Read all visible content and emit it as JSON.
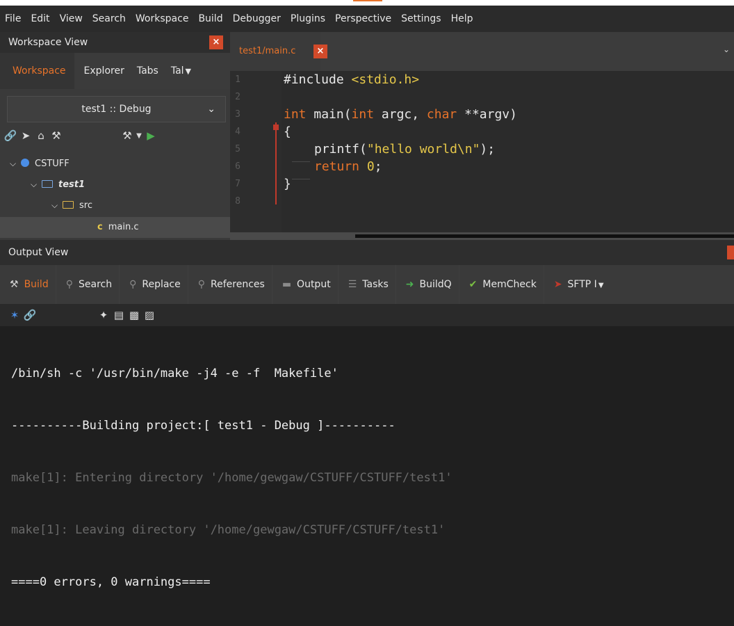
{
  "menu": [
    "File",
    "Edit",
    "View",
    "Search",
    "Workspace",
    "Build",
    "Debugger",
    "Plugins",
    "Perspective",
    "Settings",
    "Help"
  ],
  "workspace_view": {
    "title": "Workspace View",
    "close": "×",
    "tabs": [
      "Workspace",
      "Explorer",
      "Tabs",
      "Tal"
    ],
    "config": "test1 :: Debug",
    "tree": {
      "workspace": "CSTUFF",
      "project": "test1",
      "folder": "src",
      "file": "main.c"
    }
  },
  "editor": {
    "tab_label": "test1/main.c",
    "close": "×",
    "line_numbers": [
      "1",
      "2",
      "3",
      "4",
      "5",
      "6",
      "7",
      "8"
    ],
    "code": {
      "l1_directive": "#include ",
      "l1_header": "<stdio.h>",
      "l3_int": "int",
      "l3_main": " main(",
      "l3_int2": "int",
      "l3_argc": " argc, ",
      "l3_char": "char",
      "l3_argv": " **argv)",
      "l4": "{",
      "l5_call": "printf(",
      "l5_str": "\"hello world\\n\"",
      "l5_end": ");",
      "l6_ret": "return ",
      "l6_val": "0",
      "l6_end": ";",
      "l7": "}"
    }
  },
  "output_view": {
    "title": "Output View",
    "tabs": [
      "Build",
      "Search",
      "Replace",
      "References",
      "Output",
      "Tasks",
      "BuildQ",
      "MemCheck",
      "SFTP I"
    ],
    "lines": [
      "/bin/sh -c '/usr/bin/make -j4 -e -f  Makefile'",
      "----------Building project:[ test1 - Debug ]----------",
      "make[1]: Entering directory '/home/gewgaw/CSTUFF/CSTUFF/test1'",
      "make[1]: Leaving directory '/home/gewgaw/CSTUFF/CSTUFF/test1'",
      "====0 errors, 0 warnings===="
    ]
  },
  "colors": {
    "accent": "#e8732a",
    "close_button": "#d24a2a",
    "string": "#e6c84a",
    "background": "#1f1f1f"
  }
}
